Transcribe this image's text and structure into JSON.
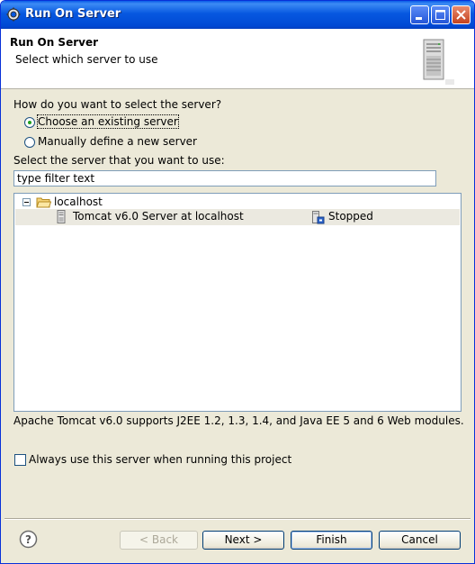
{
  "window": {
    "title": "Run On Server"
  },
  "header": {
    "title": "Run On Server",
    "subtitle": "Select which server to use"
  },
  "question": "How do you want to select the server?",
  "options": [
    {
      "label": "Choose an existing server",
      "selected": true
    },
    {
      "label": "Manually define a new server",
      "selected": false
    }
  ],
  "filter": {
    "label": "Select the server that you want to use:",
    "value": "type filter text"
  },
  "tree": {
    "host": "localhost",
    "servers": [
      {
        "name": "Tomcat v6.0 Server at localhost",
        "state": "Stopped"
      }
    ]
  },
  "description": "Apache Tomcat v6.0 supports J2EE 1.2, 1.3, 1.4, and Java EE 5 and 6 Web modules.",
  "always_use": {
    "label": "Always use this server when running this project",
    "checked": false
  },
  "buttons": {
    "back": "< Back",
    "next": "Next >",
    "finish": "Finish",
    "cancel": "Cancel"
  },
  "colors": {
    "titlebar": "#0758e0",
    "dialog_bg": "#ece9d8",
    "radio_dot": "#21a121"
  }
}
